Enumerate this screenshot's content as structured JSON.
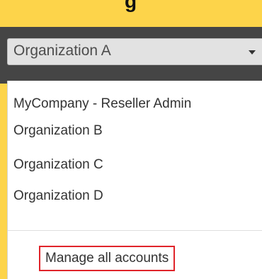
{
  "header": {
    "title_fragment": "g"
  },
  "org_selector": {
    "selected": "Organization A",
    "caret_icon": "caret-down-icon"
  },
  "dropdown": {
    "items": [
      {
        "label": "MyCompany - Reseller Admin"
      },
      {
        "label": "Organization B"
      },
      {
        "label": "Organization C"
      },
      {
        "label": "Organization D"
      }
    ],
    "manage_link": "Manage all accounts"
  },
  "colors": {
    "background": "#fdd44a",
    "panel": "#454545",
    "select_bg": "#e2e2e2",
    "highlight_border": "#e0242a"
  }
}
